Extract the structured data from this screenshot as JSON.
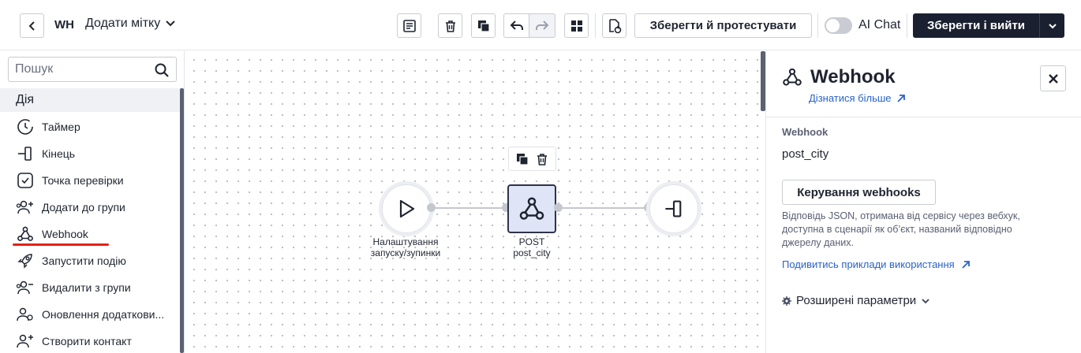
{
  "header": {
    "workflow_code": "WH",
    "tag_label": "Додати мітку",
    "save_test_label": "Зберегти й протестувати",
    "ai_chat_label": "AI Chat",
    "ai_chat_enabled": false,
    "save_exit_label": "Зберегти і вийти"
  },
  "sidebar": {
    "search_placeholder": "Пошук",
    "section_title": "Дія",
    "items": [
      {
        "label": "Таймер",
        "icon": "clock-icon"
      },
      {
        "label": "Кінець",
        "icon": "exit-icon"
      },
      {
        "label": "Точка перевірки",
        "icon": "checkpoint-icon"
      },
      {
        "label": "Додати до групи",
        "icon": "add-to-group-icon"
      },
      {
        "label": "Webhook",
        "icon": "webhook-icon",
        "highlighted": true
      },
      {
        "label": "Запустити подію",
        "icon": "rocket-icon"
      },
      {
        "label": "Видалити з групи",
        "icon": "remove-from-group-icon"
      },
      {
        "label": "Оновлення додаткови...",
        "icon": "update-contact-icon"
      },
      {
        "label": "Створити контакт",
        "icon": "create-contact-icon"
      }
    ]
  },
  "canvas": {
    "start_node_label": "Налаштування запуску/зупинки",
    "webhook_node_method": "POST",
    "webhook_node_name": "post_city"
  },
  "panel": {
    "title": "Webhook",
    "learn_more": "Дізнатися більше",
    "field_label": "Webhook",
    "field_value": "post_city",
    "manage_button": "Керування webhooks",
    "helper_text": "Відповідь JSON, отримана від сервісу через вебхук, доступна в сценарії як об’єкт, названий відповідно джерелу даних.",
    "examples_link": "Подивитись приклади використання",
    "advanced_label": "Розширені параметри"
  },
  "colors": {
    "primary_dark": "#1b2030",
    "link": "#2a63c7",
    "highlight_underline": "#e32119",
    "webhook_node_bg": "#dfe5f7"
  }
}
